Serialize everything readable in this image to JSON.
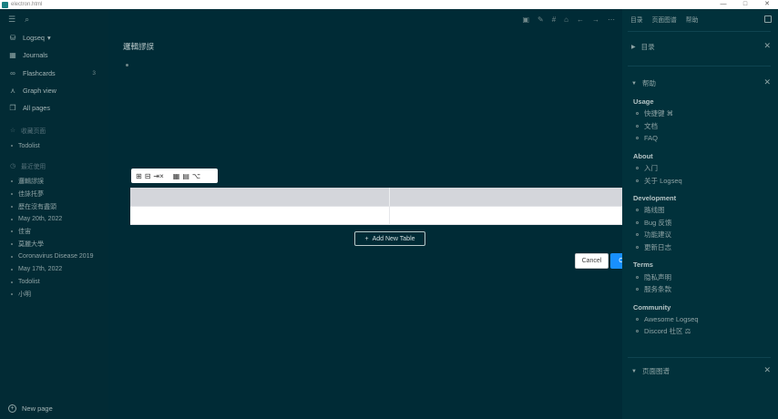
{
  "window": {
    "title": "electron.html",
    "min": "—",
    "max": "□",
    "close": "✕"
  },
  "sidebar": {
    "icons": {
      "menu": "☰",
      "search": "⌕"
    },
    "graph": "Logseq",
    "graph_caret": "▾",
    "nav": [
      {
        "icon": "database-icon",
        "glyph": "⛁",
        "label": "Logseq",
        "count": ""
      },
      {
        "icon": "calendar-icon",
        "glyph": "▦",
        "label": "Journals",
        "count": ""
      },
      {
        "icon": "infinity-icon",
        "glyph": "∞",
        "label": "Flashcards",
        "count": "3"
      },
      {
        "icon": "graph-icon",
        "glyph": "⋏",
        "label": "Graph view",
        "count": ""
      },
      {
        "icon": "pages-icon",
        "glyph": "❐",
        "label": "All pages",
        "count": ""
      }
    ],
    "favorites_title": "收藏页面",
    "favorites": [
      "Todolist"
    ],
    "recent_title": "最近使用",
    "recent": [
      "邏輯謬誤",
      "佳詠托夢",
      "歷在沒有盡頭",
      "May 20th, 2022",
      "佳宙",
      "莫麗大學",
      "Coronavirus Disease 2019",
      "May 17th, 2022",
      "Todolist",
      "小明"
    ],
    "new_page": "New page",
    "new_page_glyph": "+"
  },
  "main": {
    "toolbar": [
      "▣",
      "✎",
      "#",
      "⌂",
      "←",
      "→",
      "⋯"
    ],
    "page_title": "邏輯謬誤",
    "table_tools": [
      "⊞",
      "⊟",
      "⇥×",
      "▦",
      "▤",
      "⌥"
    ],
    "table": {
      "rows": 2,
      "cols": 2
    },
    "add_table": "Add New Table",
    "add_table_glyph": "+",
    "cancel": "Cancel",
    "confirm": "Confirm"
  },
  "right_sidebar": {
    "tabs": [
      "目录",
      "页面图谱",
      "帮助"
    ],
    "contents_title": "目录",
    "help_title": "帮助",
    "graph_title": "页面图谱",
    "sections": [
      {
        "title": "Usage",
        "items": [
          "快捷键 ⌘",
          "文档",
          "FAQ"
        ]
      },
      {
        "title": "About",
        "items": [
          "入门",
          "关于 Logseq"
        ]
      },
      {
        "title": "Development",
        "items": [
          "路线图",
          "Bug 反馈",
          "功能建议",
          "更新日志"
        ]
      },
      {
        "title": "Terms",
        "items": [
          "隐私声明",
          "服务条款"
        ]
      },
      {
        "title": "Community",
        "items": [
          "Awesome Logseq",
          "Discord 社区 ⚖"
        ]
      }
    ]
  }
}
